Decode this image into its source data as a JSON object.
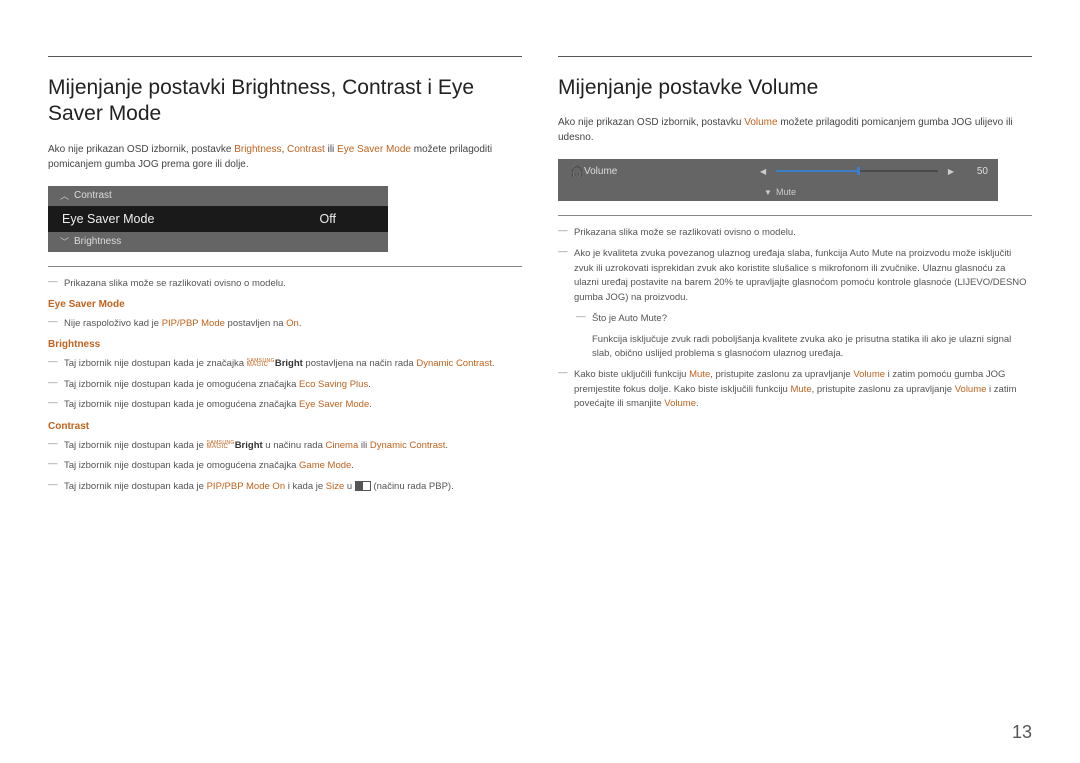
{
  "pageNumber": "13",
  "left": {
    "heading": "Mijenjanje postavki Brightness, Contrast i Eye Saver Mode",
    "intro_pre": "Ako nije prikazan OSD izbornik, postavke ",
    "intro_b": "Brightness",
    "intro_sep1": ", ",
    "intro_c": "Contrast",
    "intro_sep2": " ili ",
    "intro_e": "Eye Saver Mode",
    "intro_post": " možete prilagoditi pomicanjem gumba JOG prema gore ili dolje.",
    "osd": {
      "contrast": "Contrast",
      "eye": "Eye Saver Mode",
      "eye_value": "Off",
      "brightness": "Brightness"
    },
    "note_diff": "Prikazana slika može se razlikovati ovisno o modelu.",
    "sub_eye": "Eye Saver Mode",
    "eye_note_pre": "Nije raspoloživo kad je ",
    "eye_note_mode": "PIP/PBP Mode",
    "eye_note_mid": " postavljen na ",
    "eye_note_on": "On",
    "eye_note_post": ".",
    "sub_bright": "Brightness",
    "b1_pre": "Taj izbornik nije dostupan kada je značajka ",
    "b1_magic_top": "SAMSUNG",
    "b1_magic_bot": "MAGIC",
    "b1_bright": "Bright",
    "b1_mid": " postavljena na način rada ",
    "b1_dc": "Dynamic Contrast",
    "b1_post": ".",
    "b2_pre": "Taj izbornik nije dostupan kada je omogućena značajka ",
    "b2_esp": "Eco Saving Plus",
    "b2_post": ".",
    "b3_pre": "Taj izbornik nije dostupan kada je omogućena značajka ",
    "b3_esm": "Eye Saver Mode",
    "b3_post": ".",
    "sub_contrast": "Contrast",
    "c1_pre": "Taj izbornik nije dostupan kada je ",
    "c1_bright": "Bright",
    "c1_mid": " u načinu rada ",
    "c1_cinema": "Cinema",
    "c1_or": " ili ",
    "c1_dc": "Dynamic Contrast",
    "c1_post": ".",
    "c2_pre": "Taj izbornik nije dostupan kada je omogućena značajka ",
    "c2_gm": "Game Mode",
    "c2_post": ".",
    "c3_pre": "Taj izbornik nije dostupan kada je ",
    "c3_pip": "PIP/PBP Mode On",
    "c3_mid": " i kada je ",
    "c3_size": "Size",
    "c3_mid2": " u ",
    "c3_post": " (načinu rada PBP)."
  },
  "right": {
    "heading": "Mijenjanje postavke Volume",
    "intro_pre": "Ako nije prikazan OSD izbornik, postavku ",
    "intro_vol": "Volume",
    "intro_post": " možete prilagoditi pomicanjem gumba JOG ulijevo ili udesno.",
    "osd": {
      "volume": "Volume",
      "value": "50",
      "mute": "Mute"
    },
    "note_diff": "Prikazana slika može se razlikovati ovisno o modelu.",
    "n1": "Ako je kvaliteta zvuka povezanog ulaznog uređaja slaba, funkcija Auto Mute na proizvodu može isključiti zvuk ili uzrokovati isprekidan zvuk ako koristite slušalice s mikrofonom ili zvučnike. Ulaznu glasnoću za ulazni uređaj postavite na barem 20% te upravljajte glasnoćom pomoću kontrole glasnoće (LIJEVO/DESNO gumba JOG) na proizvodu.",
    "n1a": "Što je Auto Mute?",
    "n1b": "Funkcija isključuje zvuk radi poboljšanja kvalitete zvuka ako je prisutna statika ili ako je ulazni signal slab, obično uslijed problema s glasnoćom ulaznog uređaja.",
    "n2_pre": "Kako biste uključili funkciju ",
    "n2_mute1": "Mute",
    "n2_mid1": ", pristupite zaslonu za upravljanje ",
    "n2_vol1": "Volume",
    "n2_mid2": " i zatim pomoću gumba JOG premjestite fokus dolje. Kako biste isključili funkciju ",
    "n2_mute2": "Mute",
    "n2_mid3": ", pristupite zaslonu za upravljanje ",
    "n2_vol2": "Volume",
    "n2_mid4": " i zatim povećajte ili smanjite ",
    "n2_vol3": "Volume",
    "n2_post": "."
  }
}
